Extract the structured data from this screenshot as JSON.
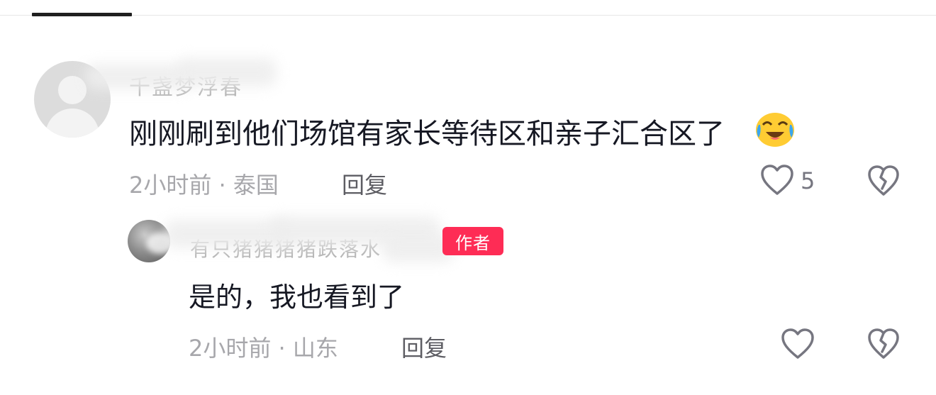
{
  "comments": [
    {
      "username": "千盏梦浮春",
      "text": "刚刚刷到他们场馆有家长等待区和亲子汇合区了",
      "emoji": "crying-laughing-emoji",
      "time_location": "2小时前 · 泰国",
      "reply_label": "回复",
      "like_count": "5"
    }
  ],
  "reply": {
    "username": "有只猪猪猪猪跌落水",
    "badge": "作者",
    "text": "是的，我也看到了",
    "time_location": "2小时前 · 山东",
    "reply_label": "回复"
  },
  "colors": {
    "badge": "#fe2c55",
    "text": "#161823",
    "meta": "#a7a7ab",
    "icon": "#767680"
  }
}
